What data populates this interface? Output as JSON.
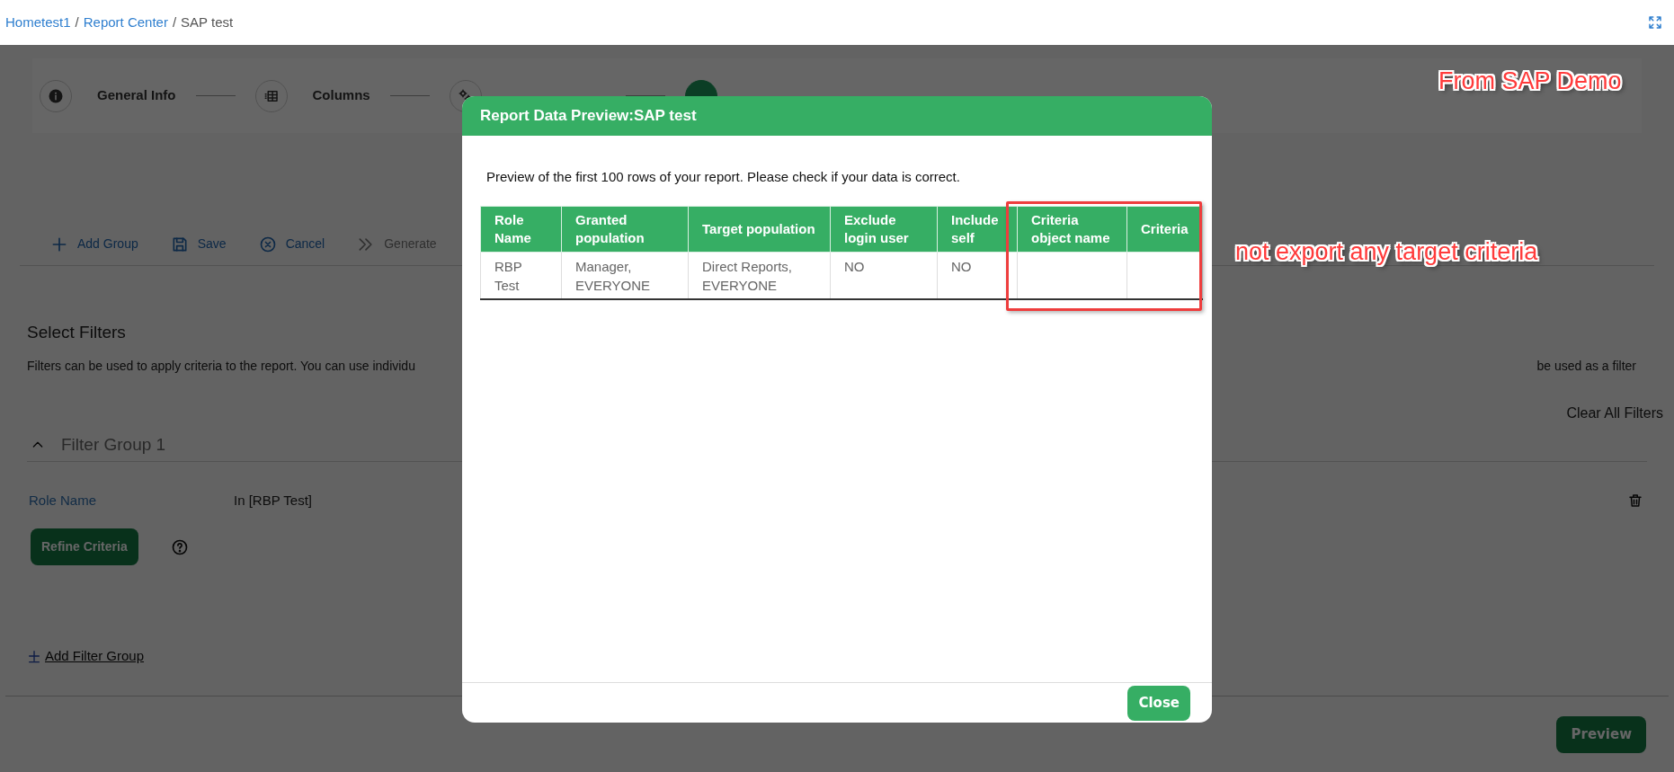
{
  "breadcrumb": {
    "separator": "/",
    "items": [
      {
        "label": "Hometest1",
        "link": true
      },
      {
        "label": "Report Center",
        "link": true
      },
      {
        "label": "SAP test",
        "link": false
      }
    ]
  },
  "stepper": [
    {
      "label": "General Info",
      "selected": false
    },
    {
      "label": "Columns",
      "selected": false
    },
    {
      "selected": false
    },
    {
      "selected": true
    }
  ],
  "toolbar": [
    {
      "label": "Add Group",
      "disabled": false
    },
    {
      "label": "Save",
      "disabled": false
    },
    {
      "label": "Cancel",
      "disabled": false
    },
    {
      "label": "Generate",
      "disabled": true
    }
  ],
  "section": {
    "title": "Select Filters",
    "description_start": "Filters can be used to apply criteria to the report. You can use individu",
    "description_end": "be used as a filter",
    "clear_all": "Clear All Filters"
  },
  "filter_groups": [
    {
      "title": "Filter Group 1",
      "expanded": true,
      "filters": [
        {
          "field": "Role Name",
          "value": "In [RBP Test]"
        }
      ],
      "refine_button": "Refine Criteria"
    }
  ],
  "add_filter_group": "Add Filter Group",
  "preview_button": "Preview",
  "dialog": {
    "title": "Report Data Preview:SAP test",
    "message": "Preview of the first 100 rows of your report. Please check if your data is correct.",
    "table": {
      "columns": [
        "Role Name",
        "Granted population",
        "Target population",
        "Exclude login user",
        "Include self",
        "Criteria object name",
        "Criteria"
      ],
      "rows": [
        [
          "RBP Test",
          "Manager, EVERYONE",
          "Direct Reports, EVERYONE",
          "NO",
          "NO"
        ]
      ]
    },
    "close_button": "Close"
  },
  "annotations": [
    {
      "kind": "label",
      "text": "From SAP Demo"
    },
    {
      "kind": "frame"
    },
    {
      "kind": "label",
      "text": "not export any target criteria"
    }
  ]
}
